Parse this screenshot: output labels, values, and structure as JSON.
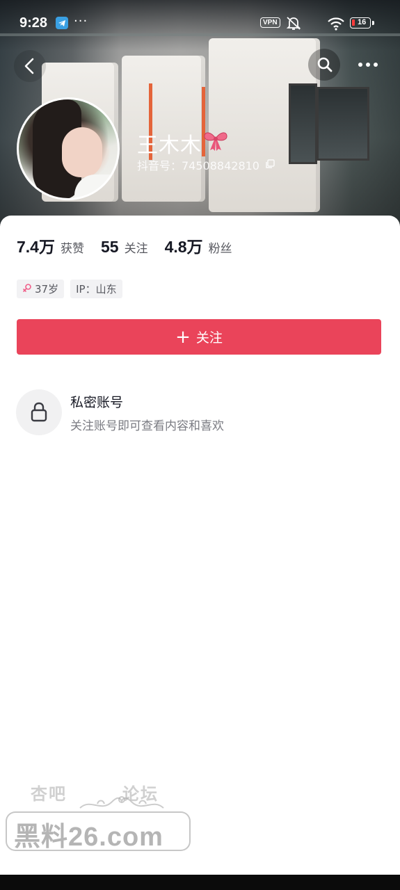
{
  "status_bar": {
    "time": "9:28",
    "dots": "···",
    "vpn": "VPN",
    "battery": "16"
  },
  "profile": {
    "name": "王木木",
    "douyin_id": "抖音号：74508842810"
  },
  "stats": [
    {
      "value": "7.4万",
      "label": "获赞"
    },
    {
      "value": "55",
      "label": "关注"
    },
    {
      "value": "4.8万",
      "label": "粉丝"
    }
  ],
  "tags": [
    {
      "icon": "female-icon",
      "label": "37岁"
    },
    {
      "label": "IP：山东"
    }
  ],
  "follow_button": {
    "plus": "+",
    "label": "关注"
  },
  "private": {
    "title": "私密账号",
    "description": "关注账号即可查看内容和喜欢"
  },
  "watermark": {
    "top_left": "杏吧",
    "top_right": "论坛",
    "main": "黑料26.com"
  },
  "colors": {
    "follow_button": "#ea445a",
    "primary_text": "#161823",
    "secondary_text": "#57585f",
    "tag_bg": "#f2f2f4"
  }
}
